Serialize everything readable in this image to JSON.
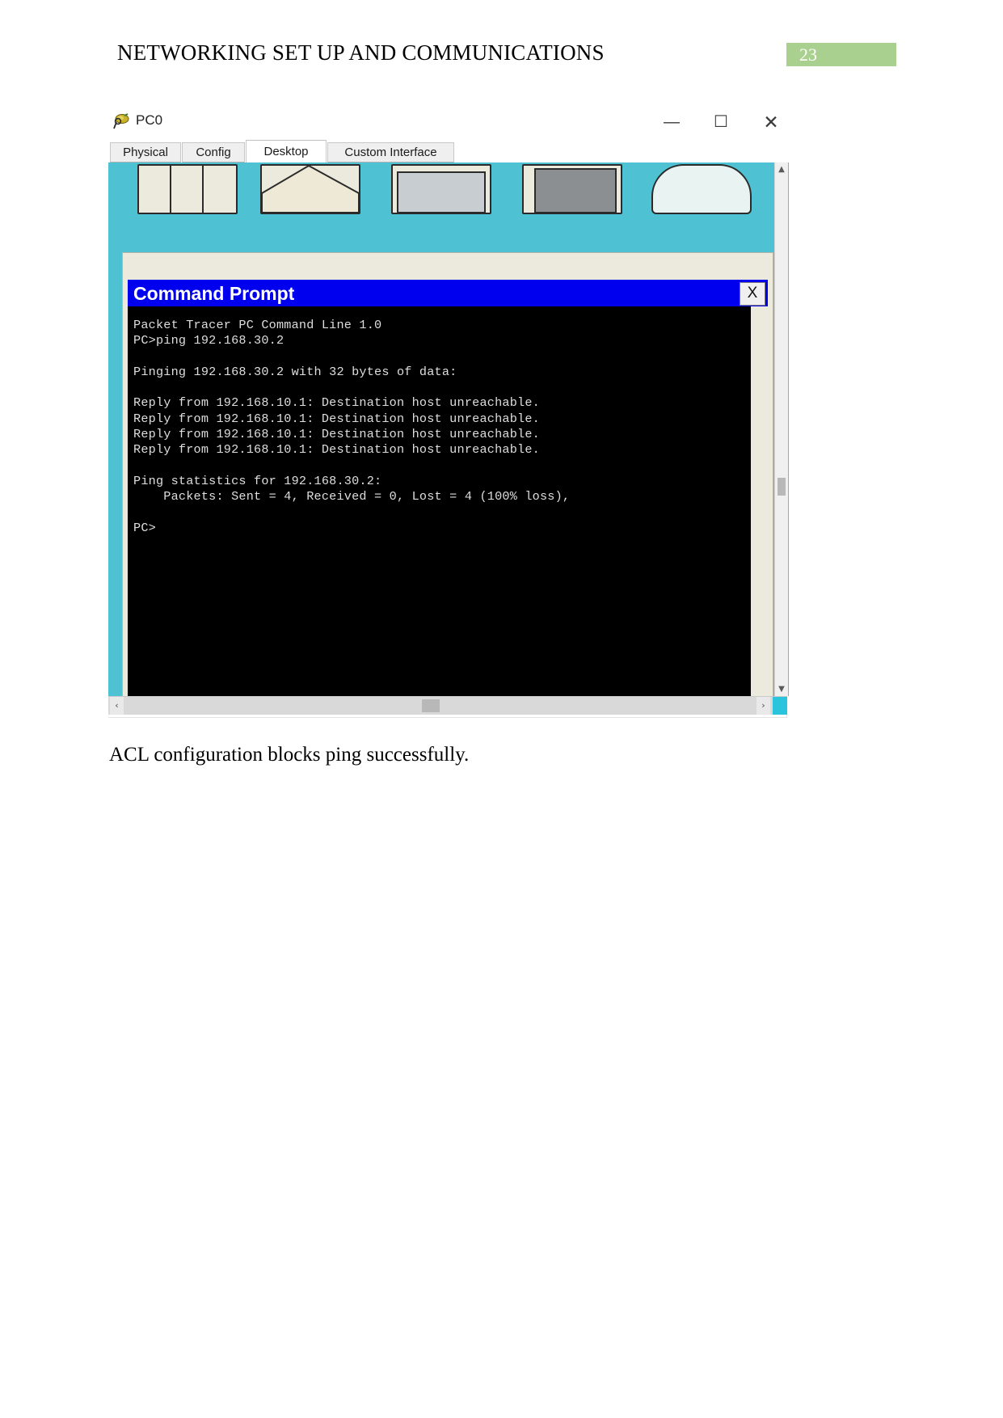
{
  "document": {
    "header_title": "NETWORKING SET UP AND COMMUNICATIONS",
    "page_number": "23",
    "page_badge_color": "#a9d08e",
    "caption": "ACL configuration blocks ping successfully."
  },
  "pt_window": {
    "title": "PC0",
    "app_icon": "packet-tracer-pc-icon",
    "controls": {
      "minimize": "—",
      "maximize": "☐",
      "close": "✕"
    },
    "tabs": [
      {
        "label": "Physical",
        "active": false
      },
      {
        "label": "Config",
        "active": false
      },
      {
        "label": "Desktop",
        "active": true
      },
      {
        "label": "Custom Interface",
        "active": false
      }
    ],
    "desktop_background_color": "#4ec2d3",
    "scrollbars": {
      "v_up": "▲",
      "v_down": "▼",
      "h_left": "‹",
      "h_right": "›"
    }
  },
  "cmd_window": {
    "title": "Command Prompt",
    "title_bar_color": "#0000ee",
    "close_label": "X",
    "screen_background": "#000000",
    "screen_text_color": "#dedede",
    "terminal_lines": [
      "Packet Tracer PC Command Line 1.0",
      "PC>ping 192.168.30.2",
      "",
      "Pinging 192.168.30.2 with 32 bytes of data:",
      "",
      "Reply from 192.168.10.1: Destination host unreachable.",
      "Reply from 192.168.10.1: Destination host unreachable.",
      "Reply from 192.168.10.1: Destination host unreachable.",
      "Reply from 192.168.10.1: Destination host unreachable.",
      "",
      "Ping statistics for 192.168.30.2:",
      "    Packets: Sent = 4, Received = 0, Lost = 4 (100% loss),",
      "",
      "PC>"
    ],
    "terminal_text": "Packet Tracer PC Command Line 1.0\nPC>ping 192.168.30.2\n\nPinging 192.168.30.2 with 32 bytes of data:\n\nReply from 192.168.10.1: Destination host unreachable.\nReply from 192.168.10.1: Destination host unreachable.\nReply from 192.168.10.1: Destination host unreachable.\nReply from 192.168.10.1: Destination host unreachable.\n\nPing statistics for 192.168.30.2:\n    Packets: Sent = 4, Received = 0, Lost = 4 (100% loss),\n\nPC>"
  }
}
